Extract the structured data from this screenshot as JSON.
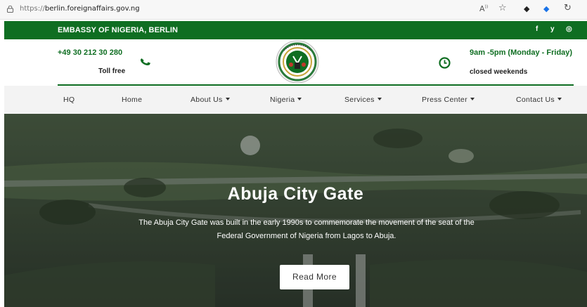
{
  "browser": {
    "url_scheme": "https://",
    "url_host": "berlin.foreignaffairs.gov.ng",
    "icons": [
      "lock-icon",
      "read-aloud-icon",
      "favorite-star-icon",
      "extension-icon",
      "extension-diamond-icon",
      "copilot-icon"
    ]
  },
  "topbar": {
    "embassy_name": "EMBASSY OF NIGERIA, BERLIN",
    "social": [
      {
        "name": "facebook-icon",
        "glyph": "f"
      },
      {
        "name": "twitter-icon",
        "glyph": "y"
      },
      {
        "name": "instagram-icon",
        "glyph": "◎"
      }
    ]
  },
  "contact": {
    "phone": "+49 30 212 30 280",
    "phone_note": "Toll free",
    "hours": "9am -5pm (Monday - Friday)",
    "hours_note": "closed weekends"
  },
  "nav": {
    "items": [
      {
        "label": "HQ",
        "dropdown": false
      },
      {
        "label": "Home",
        "dropdown": false
      },
      {
        "label": "About Us",
        "dropdown": true
      },
      {
        "label": "Nigeria",
        "dropdown": true
      },
      {
        "label": "Services",
        "dropdown": true
      },
      {
        "label": "Press Center",
        "dropdown": true
      },
      {
        "label": "Contact Us",
        "dropdown": true
      }
    ]
  },
  "hero": {
    "title": "Abuja City Gate",
    "description": "The Abuja City Gate was built in the early 1990s to commemorate the movement of the seat of the Federal Government of Nigeria from Lagos to Abuja.",
    "button_label": "Read More"
  },
  "colors": {
    "brand_green": "#0f6e22",
    "nav_bg": "#f3f3f3"
  }
}
